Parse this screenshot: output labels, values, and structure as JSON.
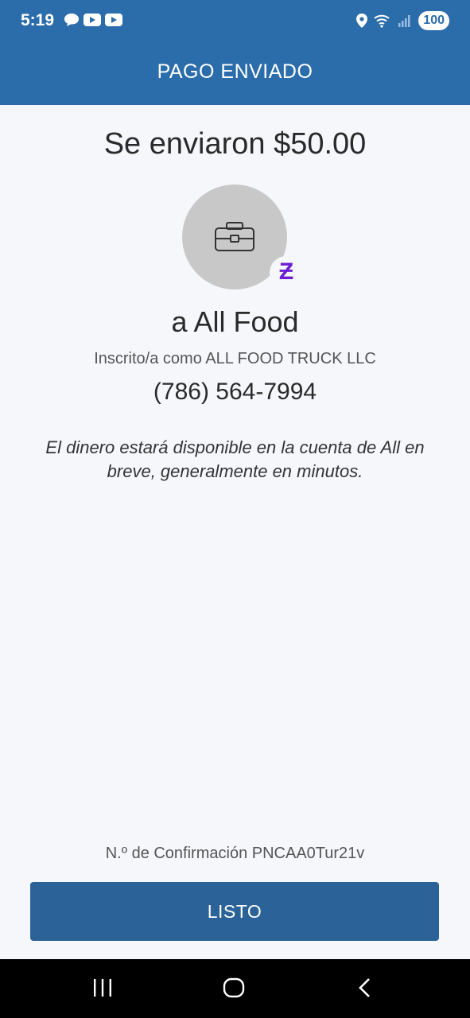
{
  "status_bar": {
    "time": "5:19",
    "battery": "100",
    "left_icons": [
      "chat-icon",
      "youtube-icon",
      "youtube-icon"
    ],
    "right_icons": [
      "location-icon",
      "wifi-icon",
      "signal-icon"
    ]
  },
  "header": {
    "title": "PAGO ENVIADO"
  },
  "summary": {
    "amount_title": "Se enviaron $50.00",
    "recipient": "a All Food",
    "enrolled_as": "Inscrito/a como ALL FOOD TRUCK LLC",
    "phone": "(786) 564-7994",
    "note": "El dinero estará disponible en la cuenta de All en breve, generalmente en minutos.",
    "badge_symbol": "Ƶ"
  },
  "footer": {
    "confirmation": "N.º de Confirmación PNCAA0Tur21v",
    "done_label": "LISTO"
  },
  "colors": {
    "brand_blue": "#2b6cab",
    "button_blue": "#2b6399",
    "zelle_purple": "#6d1ed4"
  }
}
